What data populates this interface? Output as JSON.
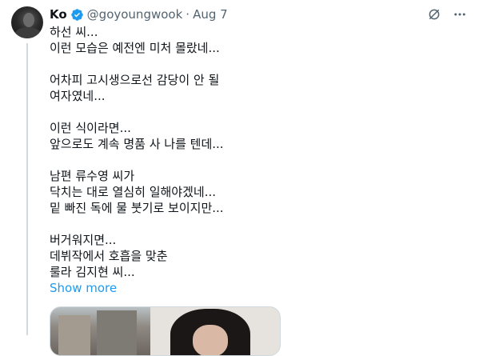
{
  "tweet": {
    "author_name": "Ko",
    "handle": "@goyoungwook",
    "separator": "·",
    "date": "Aug 7",
    "verified": true,
    "lines": [
      "하선 씨...",
      "이런 모습은 예전엔 미처 몰랐네...",
      "",
      "어차피 고시생으로선 감당이 안 될",
      "여자였네...",
      "",
      "이런 식이라면...",
      "앞으로도 계속 명품 사 나를 텐데...",
      "",
      "남편 류수영 씨가",
      "닥치는 대로 열심히 일해야겠네...",
      "밑 빠진 독에 물 붓기로 보이지만...",
      "",
      "버거워지면...",
      "데뷔작에서 호흡을 맞춘",
      "룰라 김지현 씨..."
    ],
    "show_more_label": "Show more"
  },
  "icons": {
    "verified": "verified-badge-icon",
    "grok": "grok-icon",
    "more": "more-options-icon"
  },
  "colors": {
    "accent": "#1d9bf0",
    "secondary_text": "#536471",
    "primary_text": "#0f1419",
    "thread_line": "#cfd9de"
  }
}
